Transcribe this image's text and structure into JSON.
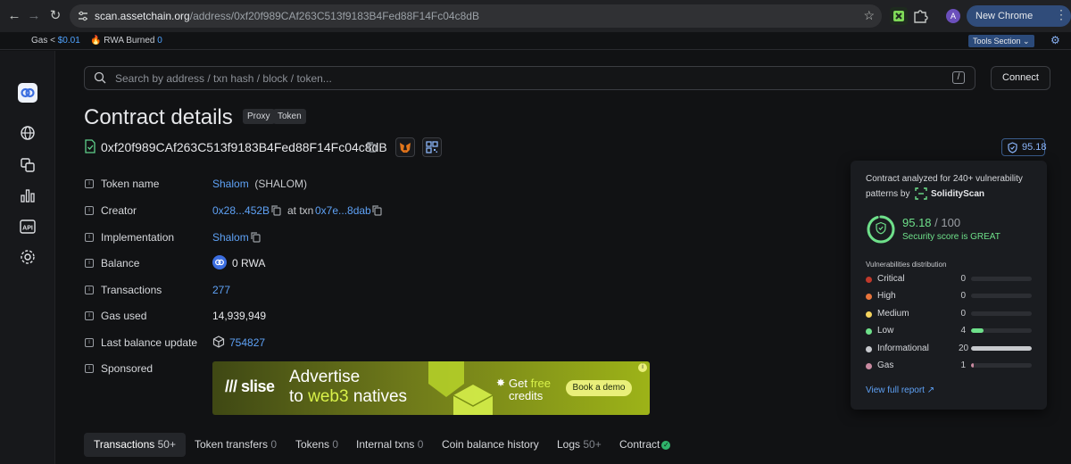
{
  "browser": {
    "url_host": "scan.assetchain.org",
    "url_path": "/address/0xf20f989CAf263C513f9183B4Fed88F14Fc04c8dB",
    "profile_initial": "A",
    "new_chrome_label": "New Chrome available"
  },
  "topbar": {
    "gas_label": "Gas <",
    "gas_value": "$0.01",
    "rwa_label": "🔥 RWA Burned",
    "rwa_value": "0",
    "tools_label": "Tools Section"
  },
  "sidebar": {
    "icons": [
      "logo-icon",
      "globe-icon",
      "tokens-icon",
      "chart-icon",
      "api-icon",
      "settings-icon"
    ],
    "api_text": "API"
  },
  "search": {
    "placeholder": "Search by address / txn hash / block / token...",
    "shortcut": "/",
    "connect_label": "Connect"
  },
  "page": {
    "title": "Contract details",
    "tags": [
      "Proxy",
      "Token"
    ],
    "address": "0xf20f989CAf263C513f9183B4Fed88F14Fc04c8dB",
    "score_badge": "95.18"
  },
  "details": {
    "token_name_label": "Token name",
    "token_name": "Shalom",
    "token_symbol": "(SHALOM)",
    "creator_label": "Creator",
    "creator_addr": "0x28...452B",
    "creator_at": "at txn",
    "creator_txn": "0x7e...8dab",
    "implementation_label": "Implementation",
    "implementation": "Shalom",
    "balance_label": "Balance",
    "balance": "0 RWA",
    "transactions_label": "Transactions",
    "transactions": "277",
    "gas_used_label": "Gas used",
    "gas_used": "14,939,949",
    "last_balance_label": "Last balance update",
    "last_balance_block": "754827",
    "sponsored_label": "Sponsored"
  },
  "ad": {
    "brand": "/// slise",
    "line1": "Advertise",
    "line2_a": "to ",
    "line2_b": "web3",
    "line2_c": " natives",
    "free_a": "Get ",
    "free_b": "free",
    "free_line2": "credits",
    "cta": "Book a demo",
    "info": "i"
  },
  "tabs": [
    {
      "label": "Transactions",
      "count": "50+"
    },
    {
      "label": "Token transfers",
      "count": "0"
    },
    {
      "label": "Tokens",
      "count": "0"
    },
    {
      "label": "Internal txns",
      "count": "0"
    },
    {
      "label": "Coin balance history",
      "count": ""
    },
    {
      "label": "Logs",
      "count": "50+"
    },
    {
      "label": "Contract",
      "count": ""
    }
  ],
  "popover": {
    "line1": "Contract analyzed for 240+ vulnerability",
    "line2": "patterns by",
    "provider": "SolidityScan",
    "score": "95.18",
    "score_total": "/ 100",
    "score_fraction": 0.9518,
    "score_desc": "Security score is GREAT",
    "dist_title": "Vulnerabilities distribution",
    "report_link": "View full report ↗",
    "rows": [
      {
        "name": "Critical",
        "count": "0",
        "fraction": 0,
        "color": "#c0392b"
      },
      {
        "name": "High",
        "count": "0",
        "fraction": 0,
        "color": "#e8743b"
      },
      {
        "name": "Medium",
        "count": "0",
        "fraction": 0,
        "color": "#f4d35e"
      },
      {
        "name": "Low",
        "count": "4",
        "fraction": 0.2,
        "color": "#6ee08a"
      },
      {
        "name": "Informational",
        "count": "20",
        "fraction": 1.0,
        "color": "#c7c9cd"
      },
      {
        "name": "Gas",
        "count": "1",
        "fraction": 0.05,
        "color": "#c98aa0"
      }
    ]
  }
}
